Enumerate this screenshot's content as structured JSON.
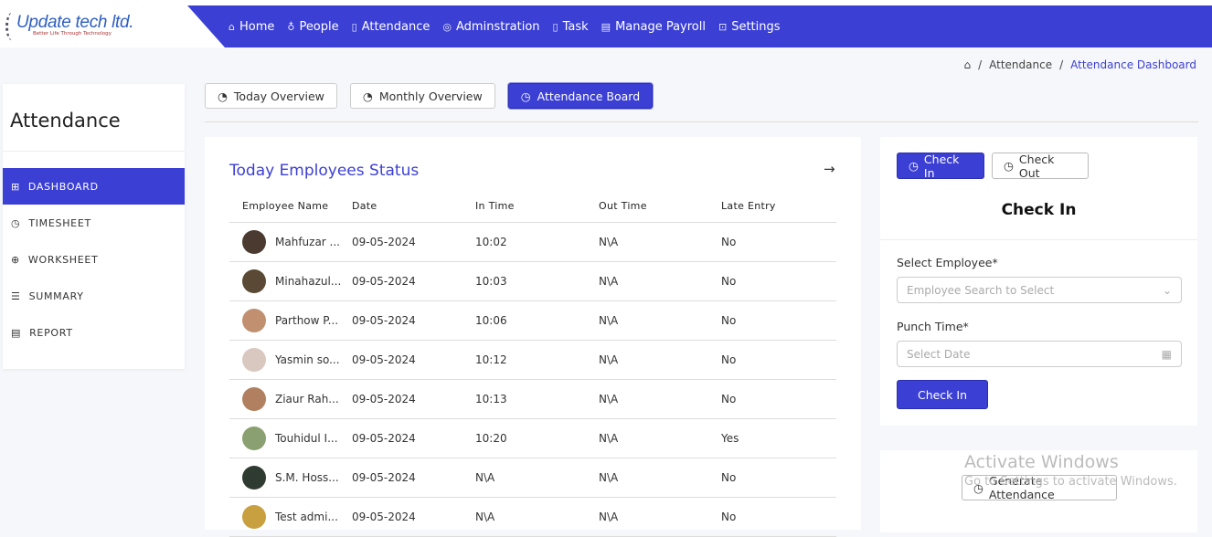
{
  "brand": {
    "name": "Update tech ltd.",
    "tagline": "Better Life Through Technology"
  },
  "nav": [
    {
      "label": "Home",
      "icon": "⌂"
    },
    {
      "label": "People",
      "icon": "♁"
    },
    {
      "label": "Attendance",
      "icon": "▯"
    },
    {
      "label": "Adminstration",
      "icon": "◎"
    },
    {
      "label": "Task",
      "icon": "▯"
    },
    {
      "label": "Manage Payroll",
      "icon": "▤"
    },
    {
      "label": "Settings",
      "icon": "⊡"
    }
  ],
  "breadcrumb": {
    "home_icon": "⌂",
    "items": [
      "Attendance",
      "Attendance Dashboard"
    ]
  },
  "sidebar": {
    "title": "Attendance",
    "items": [
      {
        "label": "DASHBOARD",
        "icon": "⊞"
      },
      {
        "label": "TIMESHEET",
        "icon": "◷"
      },
      {
        "label": "WORKSHEET",
        "icon": "⊕"
      },
      {
        "label": "SUMMARY",
        "icon": "☰"
      },
      {
        "label": "REPORT",
        "icon": "▤"
      }
    ]
  },
  "tabs": [
    "Today Overview",
    "Monthly Overview",
    "Attendance Board"
  ],
  "status": {
    "title": "Today Employees Status",
    "arrow": "→",
    "headers": [
      "Employee Name",
      "Date",
      "In Time",
      "Out Time",
      "Late Entry"
    ],
    "rows": [
      [
        "Mahfuzar ...",
        "09-05-2024",
        "10:02",
        "N\\A",
        "No"
      ],
      [
        "Minahazul...",
        "09-05-2024",
        "10:03",
        "N\\A",
        "No"
      ],
      [
        "Parthow P...",
        "09-05-2024",
        "10:06",
        "N\\A",
        "No"
      ],
      [
        "Yasmin so...",
        "09-05-2024",
        "10:12",
        "N\\A",
        "No"
      ],
      [
        "Ziaur Rah...",
        "09-05-2024",
        "10:13",
        "N\\A",
        "No"
      ],
      [
        "Touhidul I...",
        "09-05-2024",
        "10:20",
        "N\\A",
        "Yes"
      ],
      [
        "S.M. Hoss...",
        "09-05-2024",
        "N\\A",
        "N\\A",
        "No"
      ],
      [
        "Test admi...",
        "09-05-2024",
        "N\\A",
        "N\\A",
        "No"
      ]
    ]
  },
  "avatar_colors": [
    "#4a3a30",
    "#5a4a35",
    "#c09070",
    "#d8c8c0",
    "#b08060",
    "#8aa070",
    "#2f3a30",
    "#c8a040"
  ],
  "checkin": {
    "tab_in": "Check In",
    "tab_out": "Check Out",
    "heading": "Check In",
    "employee_label": "Select Employee*",
    "employee_placeholder": "Employee Search to Select",
    "punch_label": "Punch Time*",
    "punch_placeholder": "Select  Date",
    "submit": "Check In"
  },
  "generate": {
    "label": "Generate Attendance"
  },
  "watermark": {
    "title": "Activate Windows",
    "sub": "Go to Settings to activate Windows."
  }
}
